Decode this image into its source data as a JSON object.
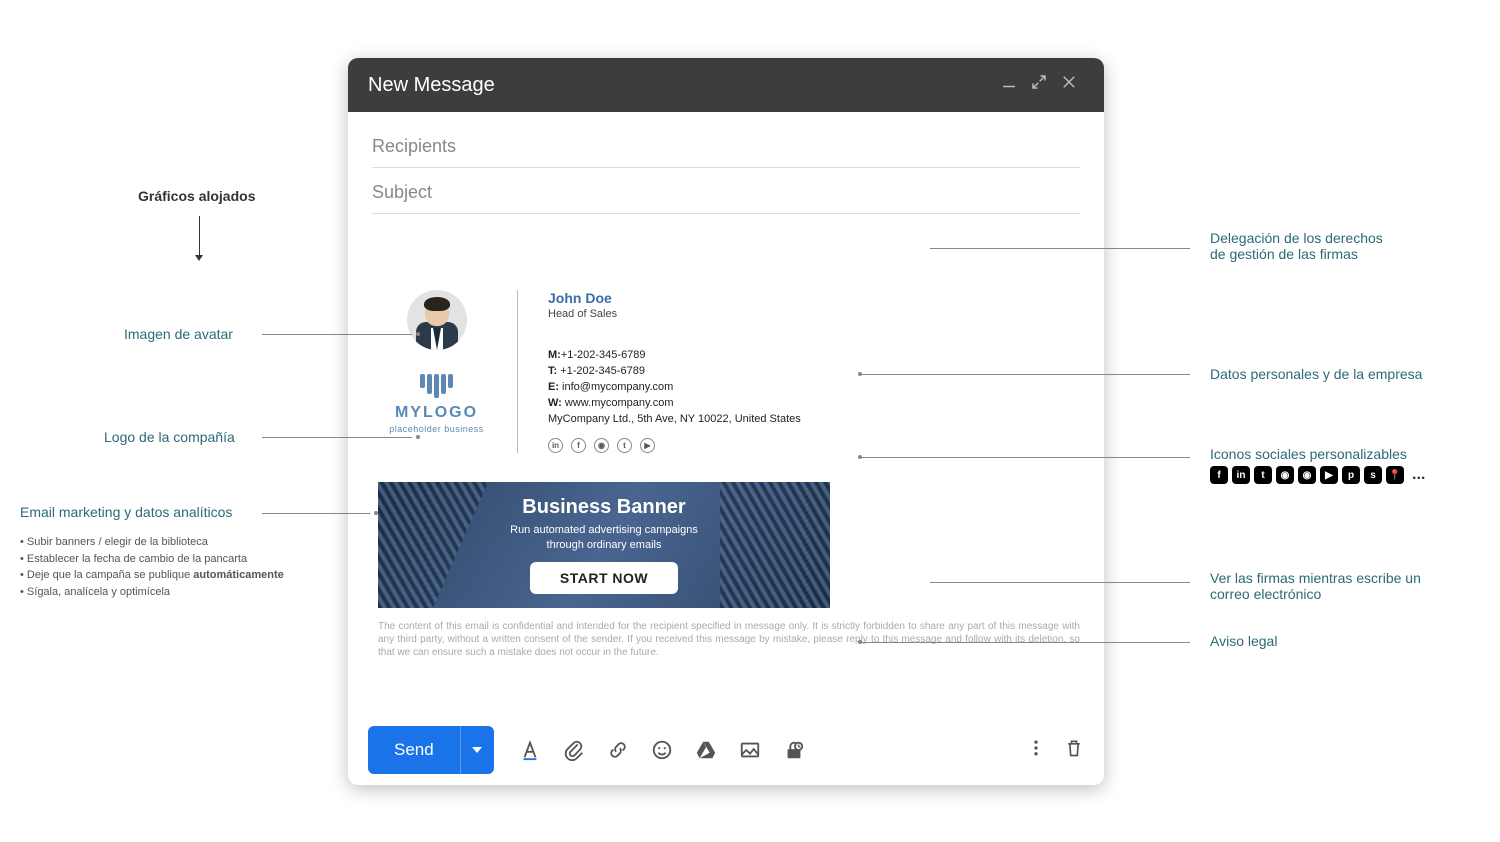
{
  "compose": {
    "title": "New Message",
    "recipients_placeholder": "Recipients",
    "subject_placeholder": "Subject",
    "send_label": "Send"
  },
  "signature": {
    "name": "John Doe",
    "job_title": "Head of Sales",
    "mobile_label": "M:",
    "mobile": "+1-202-345-6789",
    "phone_label": "T:",
    "phone": " +1-202-345-6789",
    "email_label": "E:",
    "email": " info@mycompany.com",
    "web_label": "W:",
    "web": " www.mycompany.com",
    "address": "MyCompany Ltd., 5th Ave, NY 10022, United States",
    "logo_text": "MYLOGO",
    "logo_sub": "placeholder business",
    "social": [
      "in",
      "f",
      "◉",
      "t",
      "▶"
    ]
  },
  "banner": {
    "title": "Business Banner",
    "subtitle": "Run automated advertising campaigns through ordinary emails",
    "cta": "START NOW"
  },
  "disclaimer": "The content of this email is confidential and intended for the recipient specified in message only. It is strictly forbidden to share any part of this message with any third party, without a written consent of the sender. If you received this message by mistake, please reply to this message and follow with its deletion, so that we can ensure such a mistake does not occur in the future.",
  "labels": {
    "hosted_graphics": "Gráficos alojados",
    "avatar": "Imagen de avatar",
    "company_logo": "Logo de la compañía",
    "marketing": "Email marketing y datos analíticos",
    "bullets": [
      "Subir banners / elegir de la biblioteca",
      "Establecer la fecha de cambio de la pancarta",
      "Sígala, analícela y optimícela"
    ],
    "bullet_auto_prefix": "Deje que la campaña se publique ",
    "bullet_auto_bold": "automáticamente",
    "delegation_line1": "Delegación de los derechos",
    "delegation_line2": "de gestión de las firmas",
    "personal_data": "Datos personales y de la empresa",
    "social_icons": "Iconos sociales personalizables",
    "see_signatures_line1": "Ver las firmas mientras escribe un",
    "see_signatures_line2": "correo electrónico",
    "legal": "Aviso legal",
    "social_more": "..."
  },
  "social_grid": [
    "f",
    "in",
    "t",
    "◉",
    "◉",
    "▶",
    "p",
    "s",
    "📍"
  ]
}
